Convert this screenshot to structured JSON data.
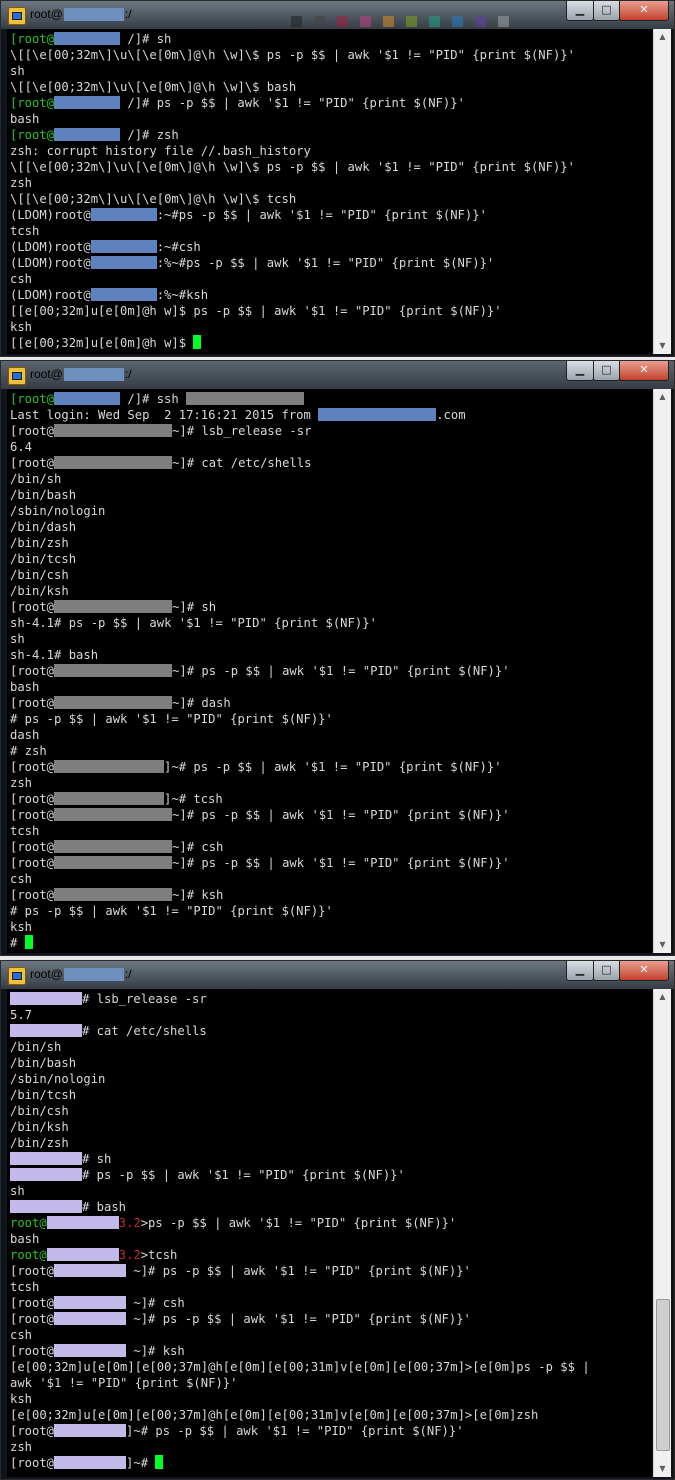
{
  "colors": {
    "prompt_green": "#27c427",
    "prompt_red": "#c42727",
    "cursor": "#00ff22",
    "terminal_text": "#d8d8d8",
    "terminal_bg": "#000000"
  },
  "windows": [
    {
      "title_prefix": "root@",
      "title_suffix": ":/",
      "controls": {
        "minimize": "▁",
        "maximize": "□",
        "close": "✕"
      },
      "lines": [
        [
          {
            "t": "[root@",
            "c": "green"
          },
          {
            "redact": "blue",
            "w": 66
          },
          {
            "t": " /]# sh"
          }
        ],
        [
          {
            "t": "\\[[\\e[00;32m\\]\\u\\[\\e[0m\\]@\\h \\w]\\$ ps -p $$ | awk '$1 != \"PID\" {print $(NF)}'"
          }
        ],
        [
          {
            "t": "sh"
          }
        ],
        [
          {
            "t": "\\[[\\e[00;32m\\]\\u\\[\\e[0m\\]@\\h \\w]\\$ bash"
          }
        ],
        [
          {
            "t": "[root@",
            "c": "green"
          },
          {
            "redact": "blue",
            "w": 66
          },
          {
            "t": " /]# ps -p $$ | awk '$1 != \"PID\" {print $(NF)}'"
          }
        ],
        [
          {
            "t": "bash"
          }
        ],
        [
          {
            "t": "[root@",
            "c": "green"
          },
          {
            "redact": "blue",
            "w": 66
          },
          {
            "t": " /]# zsh"
          }
        ],
        [
          {
            "t": "zsh: corrupt history file //.bash_history"
          }
        ],
        [
          {
            "t": "\\[[\\e[00;32m\\]\\u\\[\\e[0m\\]@\\h \\w]\\$ ps -p $$ | awk '$1 != \"PID\" {print $(NF)}'"
          }
        ],
        [
          {
            "t": "zsh"
          }
        ],
        [
          {
            "t": "\\[[\\e[00;32m\\]\\u\\[\\e[0m\\]@\\h \\w]\\$ tcsh"
          }
        ],
        [
          {
            "t": "(LDOM)root@"
          },
          {
            "redact": "blue",
            "w": 66
          },
          {
            "t": ":~#ps -p $$ | awk '$1 != \"PID\" {print $(NF)}'"
          }
        ],
        [
          {
            "t": "tcsh"
          }
        ],
        [
          {
            "t": "(LDOM)root@"
          },
          {
            "redact": "blue",
            "w": 66
          },
          {
            "t": ":~#csh"
          }
        ],
        [
          {
            "t": "(LDOM)root@"
          },
          {
            "redact": "blue",
            "w": 66
          },
          {
            "t": ":%~#ps -p $$ | awk '$1 != \"PID\" {print $(NF)}'"
          }
        ],
        [
          {
            "t": "csh"
          }
        ],
        [
          {
            "t": "(LDOM)root@"
          },
          {
            "redact": "blue",
            "w": 66
          },
          {
            "t": ":%~#ksh"
          }
        ],
        [
          {
            "t": "[[e[00;32m]u[e[0m]@h w]$ ps -p $$ | awk '$1 != \"PID\" {print $(NF)}'"
          }
        ],
        [
          {
            "t": "ksh"
          }
        ],
        [
          {
            "t": "[[e[00;32m]u[e[0m]@h w]$ "
          },
          {
            "cursor": true
          }
        ]
      ]
    },
    {
      "title_prefix": "root@",
      "title_suffix": ":/",
      "controls": {
        "minimize": "▁",
        "maximize": "□",
        "close": "✕"
      },
      "lines": [
        [
          {
            "t": "[root@",
            "c": "green"
          },
          {
            "redact": "blue",
            "w": 66
          },
          {
            "t": " /]# ssh "
          },
          {
            "redact": "gray",
            "w": 118
          }
        ],
        [
          {
            "t": "Last login: Wed Sep  2 17:16:21 2015 from "
          },
          {
            "redact": "blue",
            "w": 118
          },
          {
            "t": ".com"
          }
        ],
        [
          {
            "t": "[root@"
          },
          {
            "redact": "gray",
            "w": 118
          },
          {
            "t": "~]# lsb_release -sr"
          }
        ],
        [
          {
            "t": "6.4"
          }
        ],
        [
          {
            "t": "[root@"
          },
          {
            "redact": "gray",
            "w": 118
          },
          {
            "t": "~]# cat /etc/shells"
          }
        ],
        [
          {
            "t": "/bin/sh"
          }
        ],
        [
          {
            "t": "/bin/bash"
          }
        ],
        [
          {
            "t": "/sbin/nologin"
          }
        ],
        [
          {
            "t": "/bin/dash"
          }
        ],
        [
          {
            "t": "/bin/zsh"
          }
        ],
        [
          {
            "t": "/bin/tcsh"
          }
        ],
        [
          {
            "t": "/bin/csh"
          }
        ],
        [
          {
            "t": "/bin/ksh"
          }
        ],
        [
          {
            "t": "[root@"
          },
          {
            "redact": "gray",
            "w": 118
          },
          {
            "t": "~]# sh"
          }
        ],
        [
          {
            "t": "sh-4.1# ps -p $$ | awk '$1 != \"PID\" {print $(NF)}'"
          }
        ],
        [
          {
            "t": "sh"
          }
        ],
        [
          {
            "t": "sh-4.1# bash"
          }
        ],
        [
          {
            "t": "[root@"
          },
          {
            "redact": "gray",
            "w": 118
          },
          {
            "t": "~]# ps -p $$ | awk '$1 != \"PID\" {print $(NF)}'"
          }
        ],
        [
          {
            "t": "bash"
          }
        ],
        [
          {
            "t": "[root@"
          },
          {
            "redact": "gray",
            "w": 118
          },
          {
            "t": "~]# dash"
          }
        ],
        [
          {
            "t": "# ps -p $$ | awk '$1 != \"PID\" {print $(NF)}'"
          }
        ],
        [
          {
            "t": "dash"
          }
        ],
        [
          {
            "t": "# zsh"
          }
        ],
        [
          {
            "t": "[root@"
          },
          {
            "redact": "gray",
            "w": 110
          },
          {
            "t": "]~# ps -p $$ | awk '$1 != \"PID\" {print $(NF)}'"
          }
        ],
        [
          {
            "t": "zsh"
          }
        ],
        [
          {
            "t": "[root@"
          },
          {
            "redact": "gray",
            "w": 110
          },
          {
            "t": "]~# tcsh"
          }
        ],
        [
          {
            "t": "[root@"
          },
          {
            "redact": "gray",
            "w": 118
          },
          {
            "t": "~]# ps -p $$ | awk '$1 != \"PID\" {print $(NF)}'"
          }
        ],
        [
          {
            "t": "tcsh"
          }
        ],
        [
          {
            "t": "[root@"
          },
          {
            "redact": "gray",
            "w": 118
          },
          {
            "t": "~]# csh"
          }
        ],
        [
          {
            "t": "[root@"
          },
          {
            "redact": "gray",
            "w": 118
          },
          {
            "t": "~]# ps -p $$ | awk '$1 != \"PID\" {print $(NF)}'"
          }
        ],
        [
          {
            "t": "csh"
          }
        ],
        [
          {
            "t": "[root@"
          },
          {
            "redact": "gray",
            "w": 118
          },
          {
            "t": "~]# ksh"
          }
        ],
        [
          {
            "t": "# ps -p $$ | awk '$1 != \"PID\" {print $(NF)}'"
          }
        ],
        [
          {
            "t": "ksh"
          }
        ],
        [
          {
            "t": "# "
          },
          {
            "cursor": true
          }
        ]
      ]
    },
    {
      "title_prefix": "root@",
      "title_suffix": ":/",
      "controls": {
        "minimize": "▁",
        "maximize": "□",
        "close": "✕"
      },
      "lines": [
        [
          {
            "redact": "lav",
            "w": 72
          },
          {
            "t": "# lsb_release -sr"
          }
        ],
        [
          {
            "t": "5.7"
          }
        ],
        [
          {
            "redact": "lav",
            "w": 72
          },
          {
            "t": "# cat /etc/shells"
          }
        ],
        [
          {
            "t": "/bin/sh"
          }
        ],
        [
          {
            "t": "/bin/bash"
          }
        ],
        [
          {
            "t": "/sbin/nologin"
          }
        ],
        [
          {
            "t": "/bin/tcsh"
          }
        ],
        [
          {
            "t": "/bin/csh"
          }
        ],
        [
          {
            "t": "/bin/ksh"
          }
        ],
        [
          {
            "t": "/bin/zsh"
          }
        ],
        [
          {
            "redact": "lav",
            "w": 72
          },
          {
            "t": "# sh"
          }
        ],
        [
          {
            "redact": "lav",
            "w": 72
          },
          {
            "t": "# ps -p $$ | awk '$1 != \"PID\" {print $(NF)}'"
          }
        ],
        [
          {
            "t": "sh"
          }
        ],
        [
          {
            "redact": "lav",
            "w": 72
          },
          {
            "t": "# bash"
          }
        ],
        [
          {
            "t": "root@",
            "c": "green"
          },
          {
            "redact": "lav",
            "w": 72
          },
          {
            "t": "3.2",
            "c": "red"
          },
          {
            "t": ">ps -p $$ | awk '$1 != \"PID\" {print $(NF)}'"
          }
        ],
        [
          {
            "t": "bash"
          }
        ],
        [
          {
            "t": "root@",
            "c": "green"
          },
          {
            "redact": "lav",
            "w": 72
          },
          {
            "t": "3.2",
            "c": "red"
          },
          {
            "t": ">tcsh"
          }
        ],
        [
          {
            "t": "[root@"
          },
          {
            "redact": "lav",
            "w": 72
          },
          {
            "t": " ~]# ps -p $$ | awk '$1 != \"PID\" {print $(NF)}'"
          }
        ],
        [
          {
            "t": "tcsh"
          }
        ],
        [
          {
            "t": "[root@"
          },
          {
            "redact": "lav",
            "w": 72
          },
          {
            "t": " ~]# csh"
          }
        ],
        [
          {
            "t": "[root@"
          },
          {
            "redact": "lav",
            "w": 72
          },
          {
            "t": " ~]# ps -p $$ | awk '$1 != \"PID\" {print $(NF)}'"
          }
        ],
        [
          {
            "t": "csh"
          }
        ],
        [
          {
            "t": "[root@"
          },
          {
            "redact": "lav",
            "w": 72
          },
          {
            "t": " ~]# ksh"
          }
        ],
        [
          {
            "t": "[e[00;32m]u[e[0m][e[00;37m]@h[e[0m][e[00;31m]v[e[0m][e[00;37m]>[e[0m]ps -p $$ |"
          }
        ],
        [
          {
            "t": "awk '$1 != \"PID\" {print $(NF)}'"
          }
        ],
        [
          {
            "t": "ksh"
          }
        ],
        [
          {
            "t": "[e[00;32m]u[e[0m][e[00;37m]@h[e[0m][e[00;31m]v[e[0m][e[00;37m]>[e[0m]zsh"
          }
        ],
        [
          {
            "t": "[root@"
          },
          {
            "redact": "lav",
            "w": 72
          },
          {
            "t": "]~# ps -p $$ | awk '$1 != \"PID\" {print $(NF)}'"
          }
        ],
        [
          {
            "t": "zsh"
          }
        ],
        [
          {
            "t": "[root@"
          },
          {
            "redact": "lav",
            "w": 72
          },
          {
            "t": "]~# "
          },
          {
            "cursor": true
          }
        ]
      ]
    }
  ]
}
